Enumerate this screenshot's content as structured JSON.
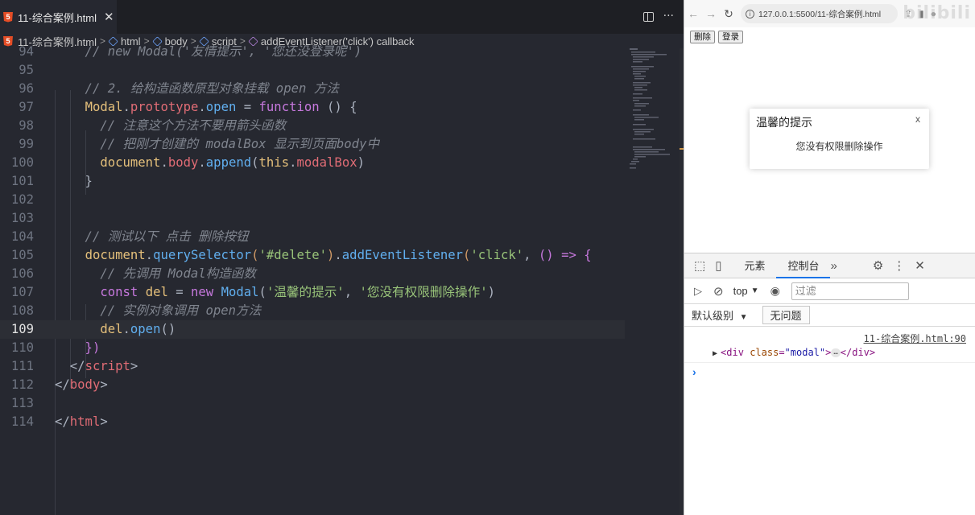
{
  "editor": {
    "tab_title": "11-综合案例.html",
    "tab_close": "✕",
    "actions": {
      "more": "···"
    },
    "breadcrumb": [
      "11-综合案例.html",
      "html",
      "body",
      "script",
      "addEventListener('click') callback"
    ],
    "lines": [
      {
        "n": "94",
        "tokens": [
          [
            "c",
            "    // new Modal('友情提示', '您还没登录呢')"
          ]
        ]
      },
      {
        "n": "95",
        "tokens": []
      },
      {
        "n": "96",
        "tokens": [
          [
            "c",
            "    // 2. 给构造函数原型对象挂载 open 方法"
          ]
        ]
      },
      {
        "n": "97",
        "tokens": [
          [
            "pu",
            "    "
          ],
          [
            "t",
            "Modal"
          ],
          [
            "pu",
            "."
          ],
          [
            "p",
            "prototype"
          ],
          [
            "pu",
            "."
          ],
          [
            "f",
            "open"
          ],
          [
            "pu",
            " = "
          ],
          [
            "k",
            "function"
          ],
          [
            "pu",
            " () {"
          ]
        ]
      },
      {
        "n": "98",
        "tokens": [
          [
            "c",
            "      // 注意这个方法不要用箭头函数"
          ]
        ]
      },
      {
        "n": "99",
        "tokens": [
          [
            "c",
            "      // 把刚才创建的 modalBox 显示到页面body中"
          ]
        ]
      },
      {
        "n": "100",
        "tokens": [
          [
            "pu",
            "      "
          ],
          [
            "t",
            "document"
          ],
          [
            "pu",
            "."
          ],
          [
            "p",
            "body"
          ],
          [
            "pu",
            "."
          ],
          [
            "f",
            "append"
          ],
          [
            "pu",
            "("
          ],
          [
            "t",
            "this"
          ],
          [
            "pu",
            "."
          ],
          [
            "p",
            "modalBox"
          ],
          [
            "pu",
            ")"
          ]
        ]
      },
      {
        "n": "101",
        "tokens": [
          [
            "pu",
            "    }"
          ]
        ]
      },
      {
        "n": "102",
        "tokens": []
      },
      {
        "n": "103",
        "tokens": []
      },
      {
        "n": "104",
        "tokens": [
          [
            "c",
            "    // 测试以下 点击 删除按钮"
          ]
        ]
      },
      {
        "n": "105",
        "tokens": [
          [
            "pu",
            "    "
          ],
          [
            "t",
            "document"
          ],
          [
            "pu",
            "."
          ],
          [
            "f",
            "querySelector"
          ],
          [
            "br1",
            "("
          ],
          [
            "s",
            "'#delete'"
          ],
          [
            "br1",
            ")"
          ],
          [
            "pu",
            "."
          ],
          [
            "f",
            "addEventListener"
          ],
          [
            "br1",
            "("
          ],
          [
            "s",
            "'click'"
          ],
          [
            "pu",
            ", "
          ],
          [
            "br2",
            "()"
          ],
          [
            "k",
            " => "
          ],
          [
            "br2",
            "{"
          ]
        ]
      },
      {
        "n": "106",
        "tokens": [
          [
            "c",
            "      // 先调用 Modal构造函数"
          ]
        ]
      },
      {
        "n": "107",
        "tokens": [
          [
            "pu",
            "      "
          ],
          [
            "k",
            "const"
          ],
          [
            "pu",
            " "
          ],
          [
            "t",
            "del"
          ],
          [
            "pu",
            " = "
          ],
          [
            "k",
            "new"
          ],
          [
            "pu",
            " "
          ],
          [
            "f",
            "Modal"
          ],
          [
            "pu",
            "("
          ],
          [
            "s",
            "'温馨的提示'"
          ],
          [
            "pu",
            ", "
          ],
          [
            "s",
            "'您没有权限删除操作'"
          ],
          [
            "pu",
            ")"
          ]
        ]
      },
      {
        "n": "108",
        "tokens": [
          [
            "c",
            "      // 实例对象调用 open方法"
          ]
        ]
      },
      {
        "n": "109",
        "tokens": [
          [
            "pu",
            "      "
          ],
          [
            "t",
            "del"
          ],
          [
            "pu",
            "."
          ],
          [
            "f",
            "open"
          ],
          [
            "pu",
            "()"
          ]
        ]
      },
      {
        "n": "110",
        "tokens": [
          [
            "br2",
            "    })"
          ]
        ]
      },
      {
        "n": "111",
        "tokens": [
          [
            "pu",
            "  </"
          ],
          [
            "tag",
            "script"
          ],
          [
            "pu",
            ">"
          ]
        ]
      },
      {
        "n": "112",
        "tokens": [
          [
            "pu",
            "</"
          ],
          [
            "tag",
            "body"
          ],
          [
            "pu",
            ">"
          ]
        ]
      },
      {
        "n": "113",
        "tokens": []
      },
      {
        "n": "114",
        "tokens": [
          [
            "pu",
            "</"
          ],
          [
            "tag",
            "html"
          ],
          [
            "pu",
            ">"
          ]
        ]
      }
    ],
    "current_line": "109"
  },
  "browser": {
    "url": "127.0.0.1:5500/11-综合案例.html",
    "watermark": "bilibili",
    "buttons": {
      "delete": "删除",
      "login": "登录"
    },
    "modal": {
      "title": "温馨的提示",
      "close": "x",
      "message": "您没有权限删除操作"
    }
  },
  "devtools": {
    "tabs": [
      "元素",
      "控制台"
    ],
    "more": "»",
    "context": "top",
    "filter_placeholder": "过滤",
    "level": "默认级别",
    "issues": "无问题",
    "log_source": "11-综合案例.html:90",
    "log_tag_open": "div",
    "log_attr_name": "class",
    "log_attr_value": "\"modal\"",
    "log_tag_close": "div",
    "log_ellipsis": "…",
    "prompt": "›"
  },
  "colors": {
    "accent": "#1a73e8",
    "editor_bg": "#262830"
  }
}
